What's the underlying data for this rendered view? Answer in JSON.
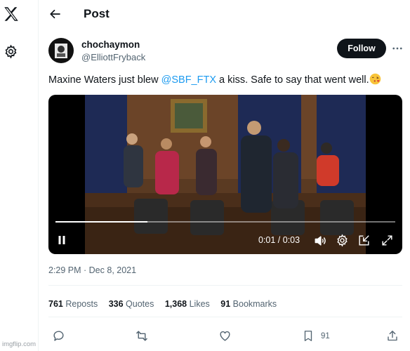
{
  "nav": {
    "icons": [
      "x-logo-icon",
      "gear-icon"
    ]
  },
  "header": {
    "title": "Post"
  },
  "tweet": {
    "display_name": "chochaymon",
    "handle": "@ElliottFryback",
    "follow_label": "Follow",
    "text_before": "Maxine Waters just blew ",
    "mention": "@SBF_FTX",
    "text_after": " a kiss. Safe to say that went well.",
    "emoji": "face-blowing-a-kiss",
    "timestamp": "2:29 PM · Dec 8, 2021"
  },
  "video": {
    "time": "0:01 / 0:03",
    "progress": 0.27,
    "state": "playing"
  },
  "stats": {
    "reposts_count": "761",
    "reposts_label": "Reposts",
    "quotes_count": "336",
    "quotes_label": "Quotes",
    "likes_count": "1,368",
    "likes_label": "Likes",
    "bookmarks_count": "91",
    "bookmarks_label": "Bookmarks"
  },
  "actions": {
    "bookmark_count": "91"
  },
  "watermark": "imgflip.com",
  "colors": {
    "accent": "#1d9bf0",
    "text": "#0f1419",
    "secondary": "#536471",
    "follow_bg": "#0f1419"
  }
}
